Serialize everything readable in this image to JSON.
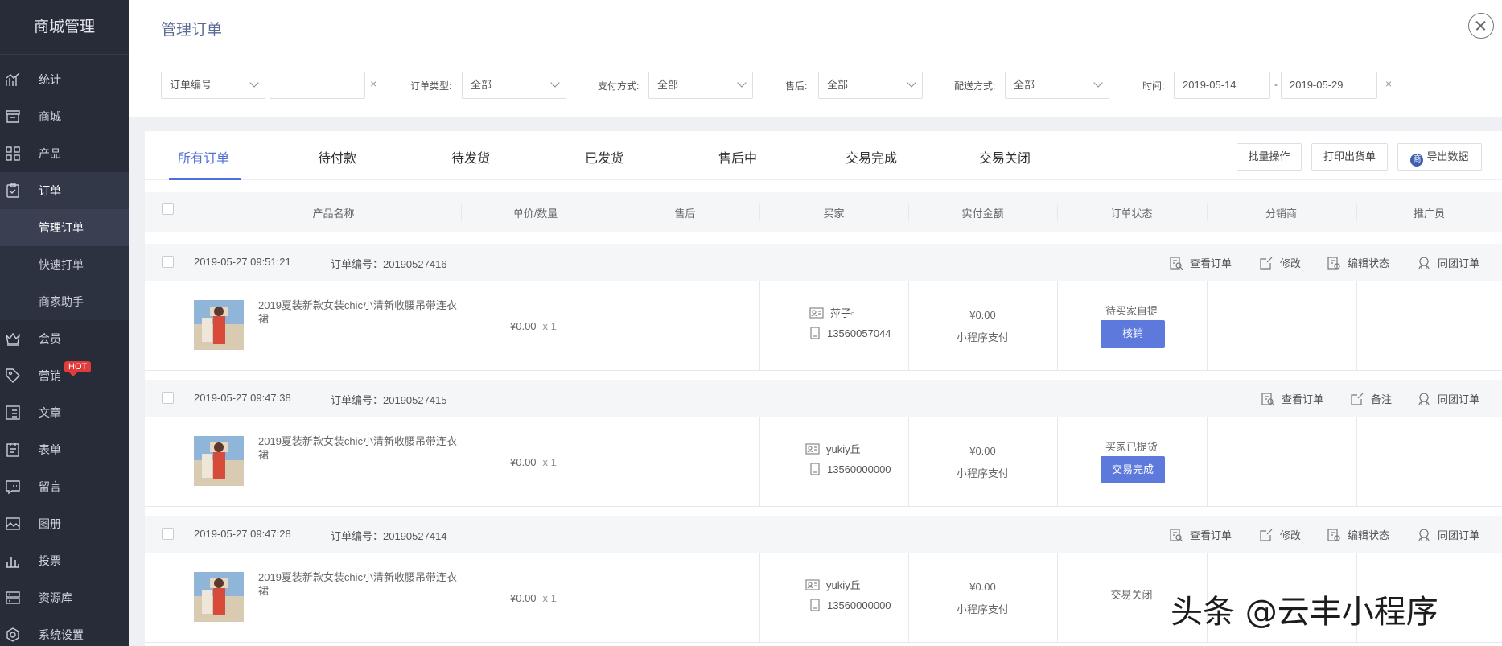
{
  "sidebar": {
    "brand": "商城管理",
    "items": [
      {
        "label": "统计",
        "icon": "stats-icon"
      },
      {
        "label": "商城",
        "icon": "store-icon"
      },
      {
        "label": "产品",
        "icon": "grid-icon"
      },
      {
        "label": "订单",
        "icon": "order-icon"
      },
      {
        "label": "会员",
        "icon": "crown-icon"
      },
      {
        "label": "营销",
        "icon": "tag-icon",
        "badge": "HOT"
      },
      {
        "label": "文章",
        "icon": "article-icon"
      },
      {
        "label": "表单",
        "icon": "form-icon"
      },
      {
        "label": "留言",
        "icon": "message-icon"
      },
      {
        "label": "图册",
        "icon": "album-icon"
      },
      {
        "label": "投票",
        "icon": "vote-icon"
      },
      {
        "label": "资源库",
        "icon": "library-icon"
      },
      {
        "label": "系统设置",
        "icon": "settings-icon"
      }
    ],
    "sub_items": [
      "管理订单",
      "快速打单",
      "商家助手"
    ]
  },
  "header": {
    "title": "管理订单"
  },
  "filters": {
    "search_field": "订单编号",
    "search_value": "",
    "clear": "×",
    "order_type_label": "订单类型:",
    "order_type": "全部",
    "payment_label": "支付方式:",
    "payment": "全部",
    "after_sale_label": "售后:",
    "after_sale": "全部",
    "delivery_label": "配送方式:",
    "delivery": "全部",
    "time_label": "时间:",
    "date_from": "2019-05-14",
    "date_sep": "-",
    "date_to": "2019-05-29"
  },
  "tabs": [
    "所有订单",
    "待付款",
    "待发货",
    "已发货",
    "售后中",
    "交易完成",
    "交易关闭"
  ],
  "actions": {
    "batch": "批量操作",
    "print": "打印出货单",
    "export": "导出数据",
    "export_icon_text": "商"
  },
  "columns": [
    "产品名称",
    "单价/数量",
    "售后",
    "买家",
    "实付金额",
    "订单状态",
    "分销商",
    "推广员"
  ],
  "orders": [
    {
      "time": "2019-05-27 09:51:21",
      "order_no": "订单编号：20190527416",
      "links": [
        "查看订单",
        "修改",
        "编辑状态",
        "同团订单"
      ],
      "product": "2019夏装新款女装chic小清新收腰吊带连衣裙",
      "price": "¥0.00",
      "qty": "x 1",
      "after_sale": "-",
      "buyer_name": "萍子▫",
      "buyer_phone": "13560057044",
      "amount": "¥0.00",
      "pay_method": "小程序支付",
      "status": "待买家自提",
      "status_button": "核销",
      "distributor": "-",
      "promoter": "-"
    },
    {
      "time": "2019-05-27 09:47:38",
      "order_no": "订单编号：20190527415",
      "links": [
        "查看订单",
        "备注",
        "同团订单"
      ],
      "product": "2019夏装新款女装chic小清新收腰吊带连衣裙",
      "price": "¥0.00",
      "qty": "x 1",
      "after_sale": "",
      "buyer_name": "yukiy丘",
      "buyer_phone": "13560000000",
      "amount": "¥0.00",
      "pay_method": "小程序支付",
      "status": "买家已提货",
      "status_button": "交易完成",
      "distributor": "-",
      "promoter": "-"
    },
    {
      "time": "2019-05-27 09:47:28",
      "order_no": "订单编号：20190527414",
      "links": [
        "查看订单",
        "修改",
        "编辑状态",
        "同团订单"
      ],
      "product": "2019夏装新款女装chic小清新收腰吊带连衣裙",
      "price": "¥0.00",
      "qty": "x 1",
      "after_sale": "-",
      "buyer_name": "yukiy丘",
      "buyer_phone": "13560000000",
      "amount": "¥0.00",
      "pay_method": "小程序支付",
      "status": "交易关闭",
      "status_button": "",
      "distributor": "",
      "promoter": ""
    }
  ],
  "watermark": "头条 @云丰小程序",
  "colors": {
    "sidebar": "#272c38",
    "accent": "#4f6fd8",
    "button": "#5e79dc",
    "hot": "#e23b3b"
  }
}
